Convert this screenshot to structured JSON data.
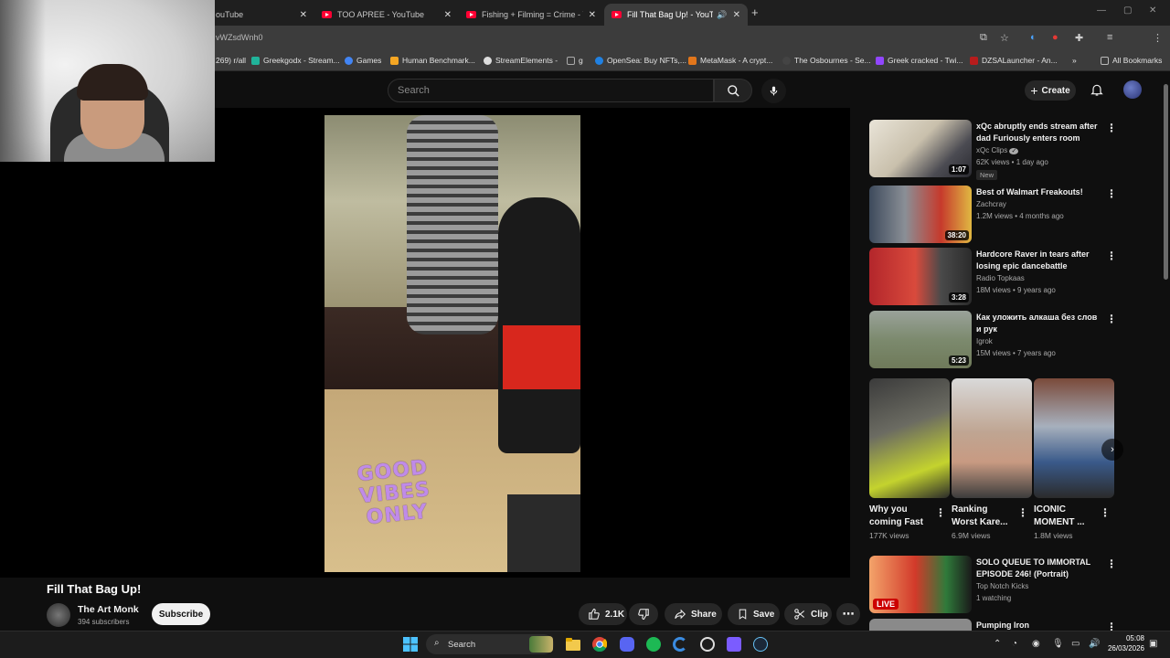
{
  "browser": {
    "tabs": [
      {
        "label": "ouTube",
        "active": false
      },
      {
        "label": "TOO APREE - YouTube",
        "active": false
      },
      {
        "label": "Fishing + Filming = Crime - YouTube",
        "active": false
      },
      {
        "label": "Fill That Bag Up! - YouTube",
        "active": true
      }
    ],
    "url": "vWZsdWnh0",
    "bookmarks": [
      {
        "label": "269) r/all",
        "color": "#ff4500"
      },
      {
        "label": "Greekgodx - Stream...",
        "color": "#20b39a"
      },
      {
        "label": "Games",
        "color": "#4285f4"
      },
      {
        "label": "Human Benchmark...",
        "color": "#f5a623"
      },
      {
        "label": "StreamElements -",
        "color": "#dddddd"
      },
      {
        "label": "g",
        "color": "#888888"
      },
      {
        "label": "OpenSea: Buy NFTs,...",
        "color": "#2081e2"
      },
      {
        "label": "MetaMask - A crypt...",
        "color": "#e2761b"
      },
      {
        "label": "The Osbournes - Se...",
        "color": "#444444"
      },
      {
        "label": "Greek cracked - Twi...",
        "color": "#9146ff"
      },
      {
        "label": "DZSALauncher - An...",
        "color": "#b71c1c"
      }
    ],
    "all_bookmarks": "All Bookmarks"
  },
  "header": {
    "search_placeholder": "Search",
    "create_label": "Create"
  },
  "video": {
    "sticker_text": [
      "GOOD",
      "VIBES",
      "ONLY"
    ],
    "title": "Fill That Bag Up!",
    "channel": "The Art Monk",
    "subscribers": "394 subscribers",
    "subscribe_label": "Subscribe",
    "likes": "2.1K",
    "share_label": "Share",
    "save_label": "Save",
    "clip_label": "Clip"
  },
  "recommendations": [
    {
      "title": "xQc abruptly ends stream after dad Furiously enters room",
      "channel": "xQc Clips",
      "meta": "62K views • 1 day ago",
      "duration": "1:07",
      "badge": "New",
      "verified": true
    },
    {
      "title": "Best of Walmart Freakouts!",
      "channel": "Zachcray",
      "meta": "1.2M views • 4 months ago",
      "duration": "38:20"
    },
    {
      "title": "Hardcore Raver in tears after losing epic dancebattle",
      "channel": "Radio Topkaas",
      "meta": "18M views • 9 years ago",
      "duration": "3:28"
    },
    {
      "title": "Как уложить алкаша без слов и рук",
      "channel": "Igrok",
      "meta": "15M views • 7 years ago",
      "duration": "5:23"
    }
  ],
  "shorts": [
    {
      "title": "Why you coming Fast",
      "views": "177K views"
    },
    {
      "title": "Ranking Worst Kare...",
      "views": "6.9M views"
    },
    {
      "title": "ICONIC MOMENT ...",
      "views": "1.8M views"
    }
  ],
  "more_recommendations": [
    {
      "title": "SOLO QUEUE TO IMMORTAL EPISODE 246! (Portrait)",
      "channel": "Top Notch Kicks",
      "meta": "1 watching",
      "live": "LIVE"
    },
    {
      "title": "Pumping Iron",
      "channel": "",
      "meta": ""
    }
  ],
  "taskbar": {
    "search_label": "Search",
    "time": "05:08",
    "date": "26/03/2026"
  },
  "colors": {
    "accent_red": "#ff0033",
    "background": "#0f0f0f",
    "pill": "#272727"
  }
}
